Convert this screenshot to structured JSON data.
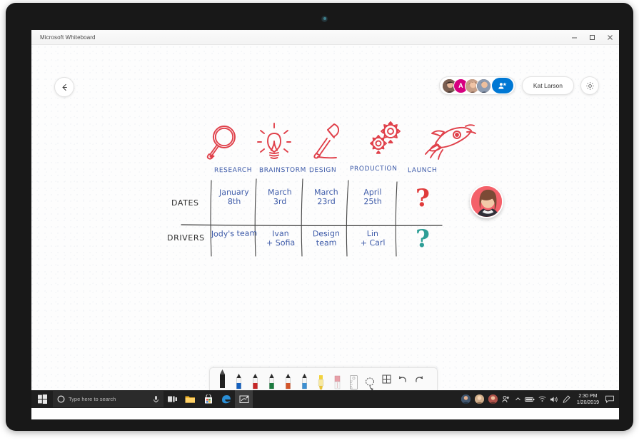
{
  "window": {
    "title": "Microsoft Whiteboard",
    "minimize_label": "–",
    "maximize_label": "☐",
    "close_label": "✕"
  },
  "header": {
    "back_label": "back-arrow",
    "user_name": "Kat Larson",
    "share_label": "share-icon",
    "settings_label": "settings-gear",
    "collaborators": [
      {
        "name": "collaborator-1",
        "type": "photo",
        "color": "#8a6a5a"
      },
      {
        "name": "collaborator-2",
        "type": "initial",
        "initial": "A",
        "color": "#d6007f"
      },
      {
        "name": "collaborator-3",
        "type": "photo",
        "color": "#b98a74"
      },
      {
        "name": "collaborator-4",
        "type": "photo",
        "color": "#6f5a4c"
      }
    ]
  },
  "board": {
    "stages": [
      {
        "label": "RESEARCH",
        "icon": "magnifying-glass-icon"
      },
      {
        "label": "BRAINSTORM",
        "icon": "lightbulb-icon"
      },
      {
        "label": "DESIGN",
        "icon": "paintbrush-icon"
      },
      {
        "label": "PRODUCTION",
        "icon": "gears-icon"
      },
      {
        "label": "LAUNCH",
        "icon": "rocket-icon"
      }
    ],
    "rows": [
      {
        "header": "DATES",
        "cells": [
          "January\n8th",
          "March\n3rd",
          "March\n23rd",
          "April\n25th"
        ],
        "unknown": "?",
        "unknown_color": "#e03c3c"
      },
      {
        "header": "DRIVERS",
        "cells": [
          "Jody's team",
          "Ivan\n+ Sofia",
          "Design\nteam",
          "Lin\n+ Carl"
        ],
        "unknown": "?",
        "unknown_color": "#2e9e96"
      }
    ],
    "ink_color": "#3e5ba9",
    "icon_color": "#e0404a"
  },
  "toolbar": {
    "tools": [
      {
        "name": "pen-black",
        "label": "Black pen",
        "color": "#1c1c1c",
        "selected": true
      },
      {
        "name": "pen-blue",
        "label": "Blue pen",
        "color": "#1560bd",
        "selected": false
      },
      {
        "name": "pen-red",
        "label": "Red pen",
        "color": "#c62828",
        "selected": false
      },
      {
        "name": "pen-green",
        "label": "Green pen",
        "color": "#1b7a3e",
        "selected": false
      },
      {
        "name": "pen-orange",
        "label": "Orange pen",
        "color": "#d2552a",
        "selected": false
      },
      {
        "name": "pen-lightblue",
        "label": "Light blue pen",
        "color": "#3d8fd1",
        "selected": false
      },
      {
        "name": "highlighter",
        "label": "Highlighter",
        "color": "#f2d23c",
        "selected": false
      },
      {
        "name": "eraser",
        "label": "Eraser",
        "color": "#e8a0a8",
        "selected": false
      },
      {
        "name": "ruler",
        "label": "Ruler",
        "color": "#cfcfcf",
        "selected": false
      },
      {
        "name": "lasso-select",
        "label": "Lasso select",
        "color": "#555555",
        "selected": false
      }
    ],
    "commands": [
      {
        "name": "insert-table",
        "glyph": "⊞",
        "label": "Insert"
      },
      {
        "name": "undo",
        "glyph": "↶",
        "label": "Undo"
      },
      {
        "name": "redo",
        "glyph": "↷",
        "label": "Redo"
      }
    ]
  },
  "taskbar": {
    "start_label": "start-button",
    "search_placeholder": "Type here to search",
    "mic_label": "microphone-icon",
    "apps": [
      {
        "name": "task-view",
        "label": "Task View",
        "active": false
      },
      {
        "name": "file-explorer",
        "label": "File Explorer",
        "active": false
      },
      {
        "name": "microsoft-store",
        "label": "Microsoft Store",
        "active": false
      },
      {
        "name": "microsoft-edge",
        "label": "Microsoft Edge",
        "active": false
      },
      {
        "name": "microsoft-whiteboard",
        "label": "Microsoft Whiteboard",
        "active": true
      }
    ],
    "people": [
      {
        "name": "my-people-1",
        "color": "#4f6d8c"
      },
      {
        "name": "my-people-2",
        "color": "#c9a27e"
      },
      {
        "name": "my-people-3",
        "color": "#b4564a"
      }
    ],
    "tray_icons": [
      {
        "name": "my-people-add-icon",
        "glyph": "⚶"
      },
      {
        "name": "show-hidden-icons-chevron",
        "glyph": "⌃"
      },
      {
        "name": "battery-icon",
        "glyph": "▭"
      },
      {
        "name": "network-icon",
        "glyph": "◠"
      },
      {
        "name": "volume-icon",
        "glyph": "🔊"
      },
      {
        "name": "pen-workspace-icon",
        "glyph": "✐"
      }
    ],
    "time": "2:30 PM",
    "date": "1/20/2019",
    "action_center_label": "action-center-icon"
  }
}
